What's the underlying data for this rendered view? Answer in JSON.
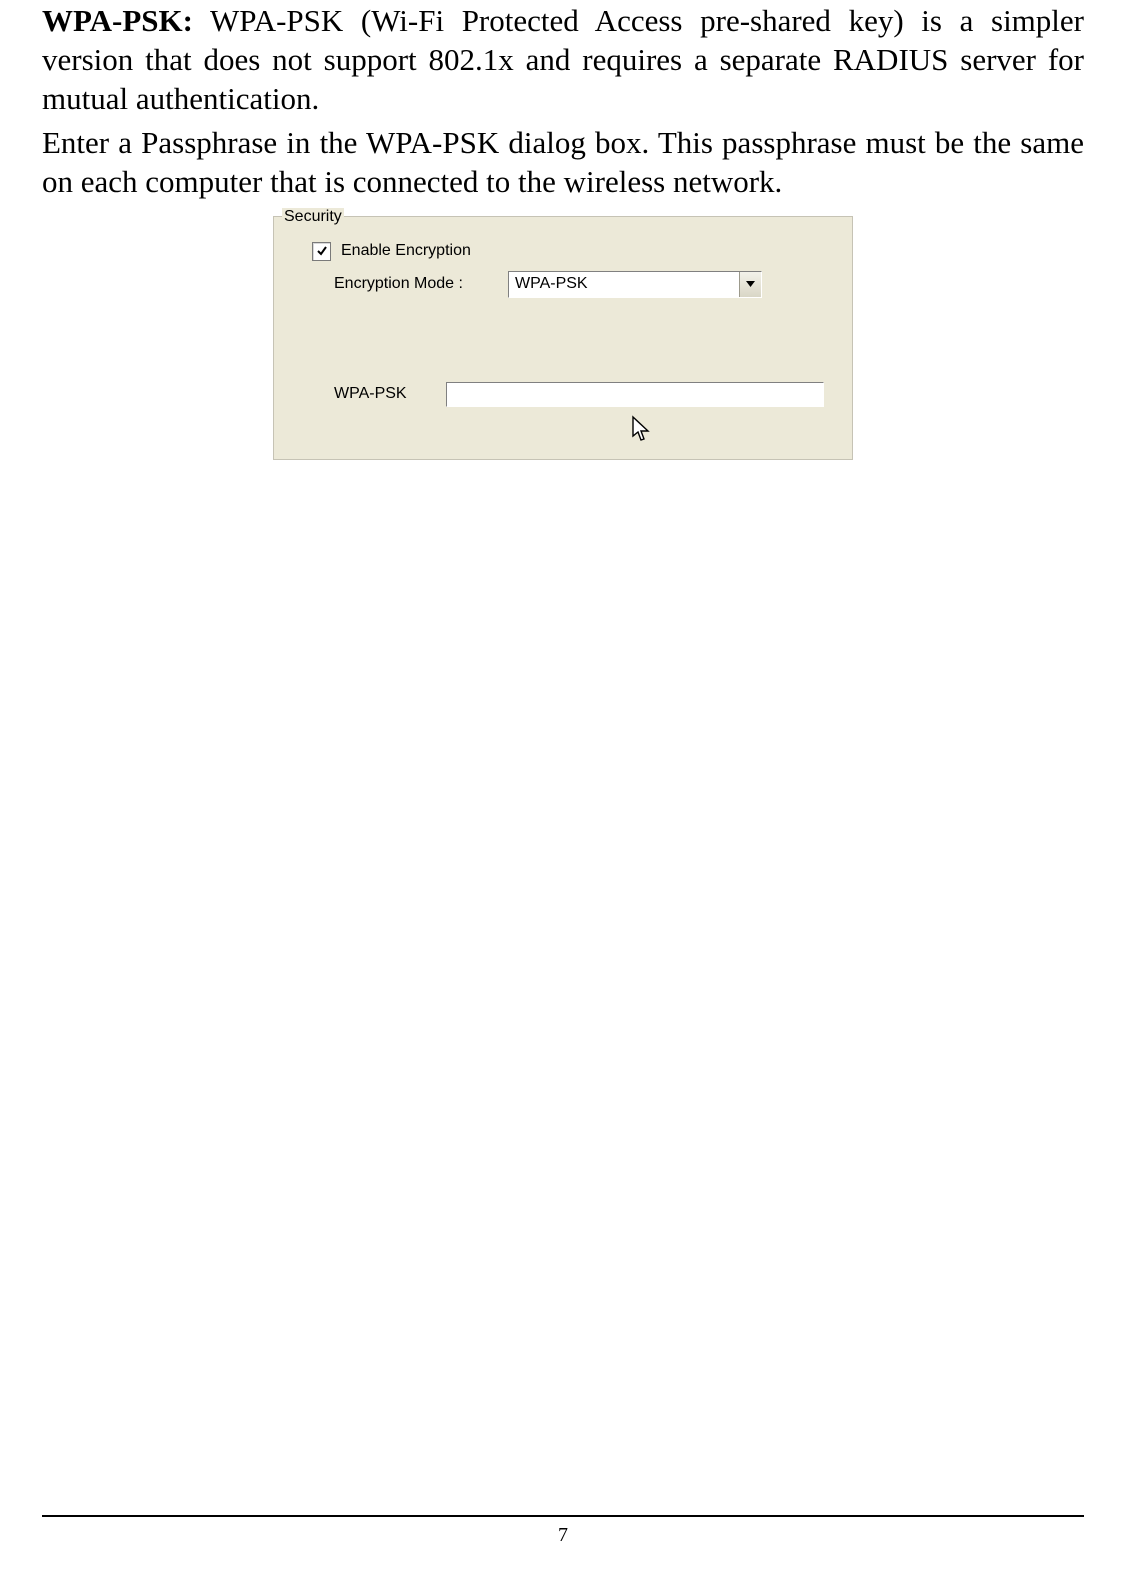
{
  "paragraphs": {
    "p1_bold_lead": "WPA-PSK:",
    "p1_rest": " WPA-PSK (Wi-Fi Protected Access pre-shared key) is a simpler version that does not support 802.1x and requires a separate RADIUS server for mutual authentication.",
    "p2": "Enter a Passphrase in the WPA-PSK dialog box. This passphrase must be the same on each computer that is connected to the wireless network."
  },
  "dialog": {
    "group_title": "Security",
    "enable_label": "Enable Encryption",
    "enable_checked": true,
    "mode_label": "Encryption Mode :",
    "mode_value": "WPA-PSK",
    "wpa_label": "WPA-PSK",
    "wpa_value": ""
  },
  "page_number": "7"
}
